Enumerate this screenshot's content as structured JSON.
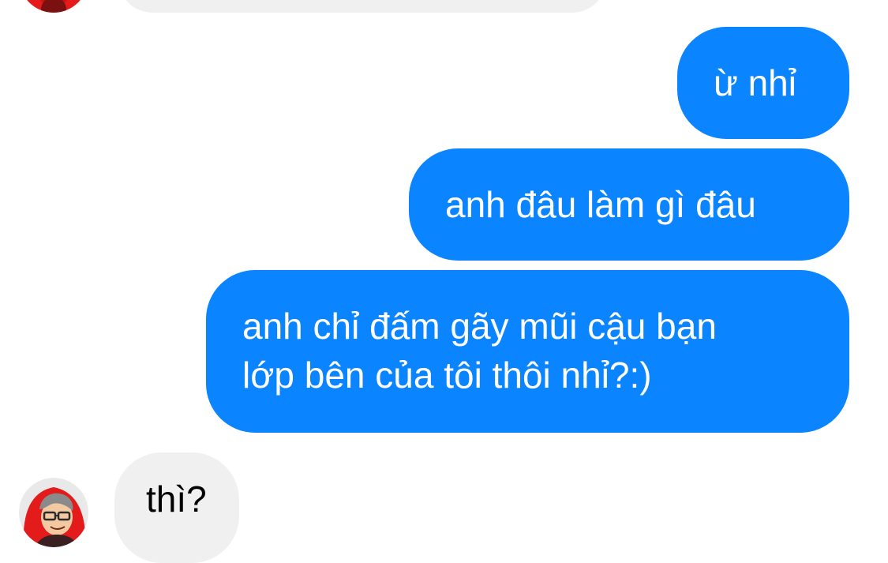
{
  "conversation": {
    "messages": [
      {
        "direction": "incoming",
        "text": ""
      },
      {
        "direction": "outgoing",
        "text": "ừ nhỉ"
      },
      {
        "direction": "outgoing",
        "text": "anh đâu làm gì đâu"
      },
      {
        "direction": "outgoing",
        "lines": [
          "anh chỉ đấm gãy mũi cậu bạn",
          "lớp bên của tôi thôi nhỉ?:)"
        ]
      },
      {
        "direction": "incoming",
        "text": "thì?"
      }
    ]
  },
  "colors": {
    "outgoing_bubble": "#0a84ff",
    "incoming_bubble": "#f0f0f0",
    "avatar_accent": "#e31b1b"
  },
  "icons": {
    "avatar": "contact-avatar-illustration"
  }
}
